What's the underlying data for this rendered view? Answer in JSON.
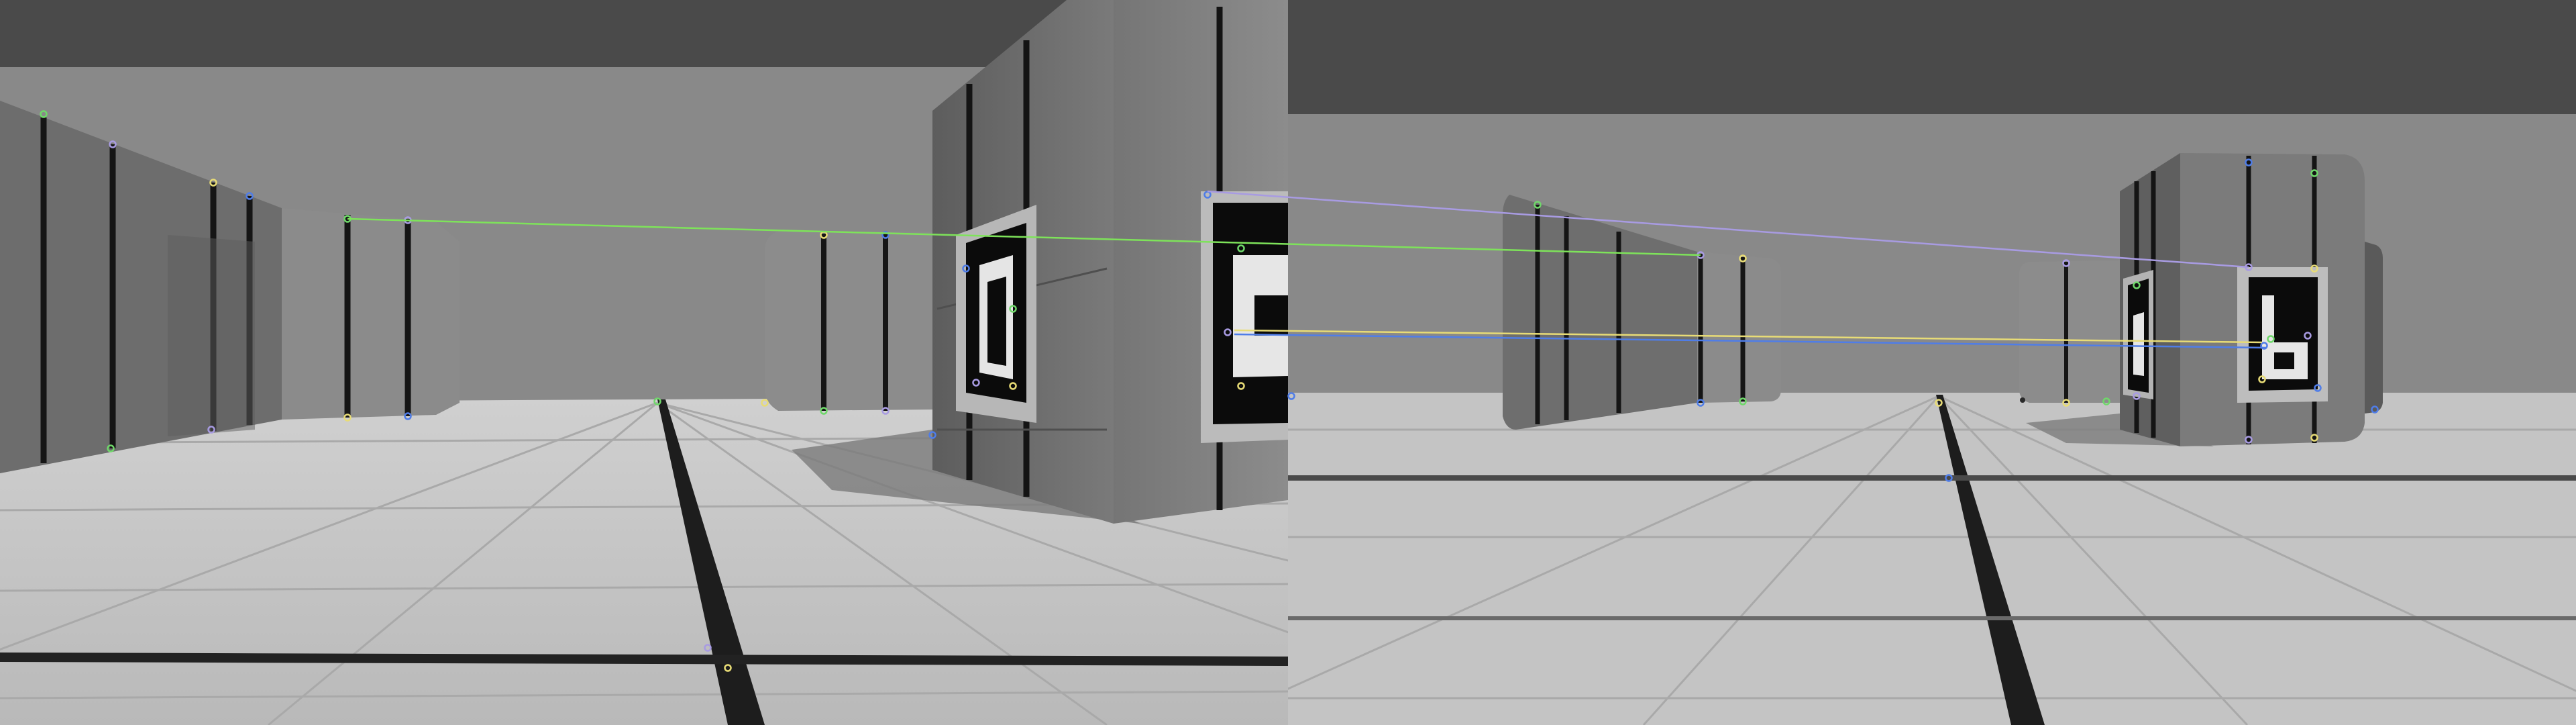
{
  "panels": [
    {
      "name": "left-camera-frame"
    },
    {
      "name": "right-camera-frame"
    }
  ],
  "colors": {
    "ceiling": "#4a4a4a",
    "wall": "#8a8a8a",
    "floor": "#c3c3c3",
    "floor_grid": "#aeaeae",
    "floor_stripe": "#1d1d1d",
    "box_fabric": "#6c6c6c",
    "box_fabric_light": "#868686",
    "box_seam": "#161616",
    "marker_border": "#b9b9b9",
    "marker_black": "#0b0b0b",
    "marker_white": "#e8e8e8",
    "match_green": "#7ee35a",
    "match_violet": "#a89be2",
    "match_yellow": "#e8dc76",
    "match_blue": "#4f7de8",
    "keypoint": "#6fd86a"
  },
  "match_count": 4
}
